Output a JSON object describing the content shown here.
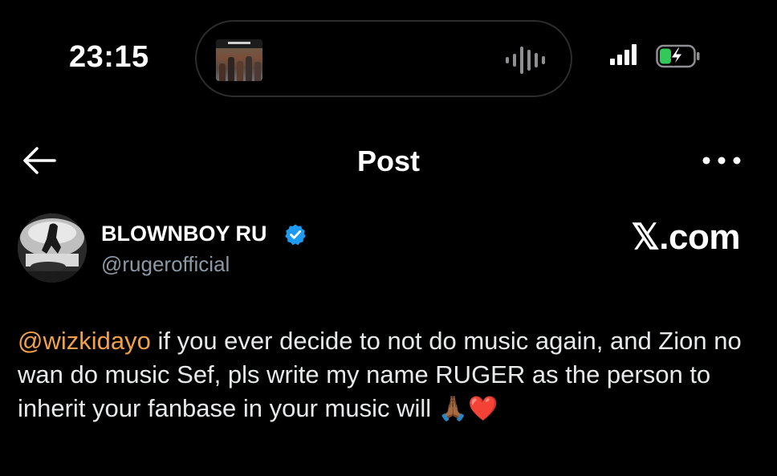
{
  "status_bar": {
    "time": "23:15",
    "album_art_label": "EXPRESS",
    "icons": [
      "waveform-icon",
      "cellular-signal-icon",
      "battery-charging-icon"
    ]
  },
  "nav": {
    "title": "Post",
    "back_icon": "arrow-left-icon",
    "more_icon": "more-horizontal-icon"
  },
  "author": {
    "name": "BLOWNBOY RU",
    "handle": "@rugerofficial",
    "verified": true,
    "brand_mark": "𝕏.com"
  },
  "post": {
    "mention": "@wizkidayo",
    "text": " if you ever decide to not do music again, and Zion no wan do music Sef, pls write my name RUGER as the person to inherit your fanbase in your music will ",
    "emoji_pray": "🙏🏾",
    "emoji_heart": "❤️"
  },
  "colors": {
    "background": "#000000",
    "text": "#e7e9ea",
    "secondary_text": "#8b98a5",
    "mention": "#f0a04b",
    "verified": "#1d9bf0",
    "battery": "#34c759"
  }
}
